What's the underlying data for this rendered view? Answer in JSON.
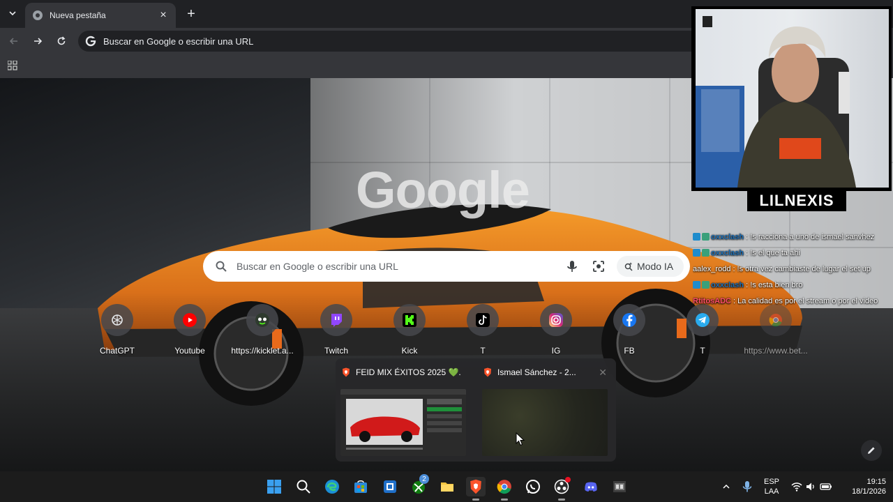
{
  "browser": {
    "tab": {
      "title": "Nueva pestaña",
      "close": "×"
    },
    "new_tab": "+",
    "omnibox_placeholder": "Buscar en Google o escribir una URL"
  },
  "ntp": {
    "logo_text": "Google",
    "search_placeholder": "Buscar en Google o escribir una URL",
    "ai_mode_label": "Modo IA",
    "shortcuts": [
      {
        "label": "ChatGPT",
        "icon": "chatgpt-icon"
      },
      {
        "label": "Youtube",
        "icon": "youtube-icon"
      },
      {
        "label": "https://kicklet.a...",
        "icon": "kicklet-icon"
      },
      {
        "label": "Twitch",
        "icon": "twitch-icon"
      },
      {
        "label": "Kick",
        "icon": "kick-icon"
      },
      {
        "label": "T",
        "icon": "tiktok-icon"
      },
      {
        "label": "IG",
        "icon": "instagram-icon"
      },
      {
        "label": "FB",
        "icon": "facebook-icon"
      },
      {
        "label": "T",
        "icon": "telegram-icon"
      },
      {
        "label": "https://www.bet...",
        "icon": "chrome-icon"
      }
    ]
  },
  "taskbar_preview": {
    "windows": [
      {
        "title": "FEID MIX ÉXITOS 2025 💚..."
      },
      {
        "title": "Ismael Sánchez - 2..."
      }
    ]
  },
  "stream": {
    "streamer_name": "LILNEXIS",
    "chat": [
      {
        "user": "oxxclash",
        "message": ": !s racciona a uno de ismael sanvhez",
        "color": "#1e6fb5"
      },
      {
        "user": "oxxclash",
        "message": ": !s el que ta ahi",
        "color": "#1e6fb5"
      },
      {
        "user": "aalex_rodd",
        "message": ": !s otra vez cambiaste de lugar el set up",
        "color": "#ffffff"
      },
      {
        "user": "oxxclash",
        "message": ": !s esta bien bro",
        "color": "#1e6fb5"
      },
      {
        "user": "RtitosADC",
        "message": ": La calidad es por el stream o por el video",
        "color": "#ff4d6a"
      }
    ]
  },
  "windows_taskbar": {
    "language": "ESP",
    "layout": "LAA",
    "time": "19:15",
    "date": "18/1/2026",
    "notification_badge": "2"
  }
}
